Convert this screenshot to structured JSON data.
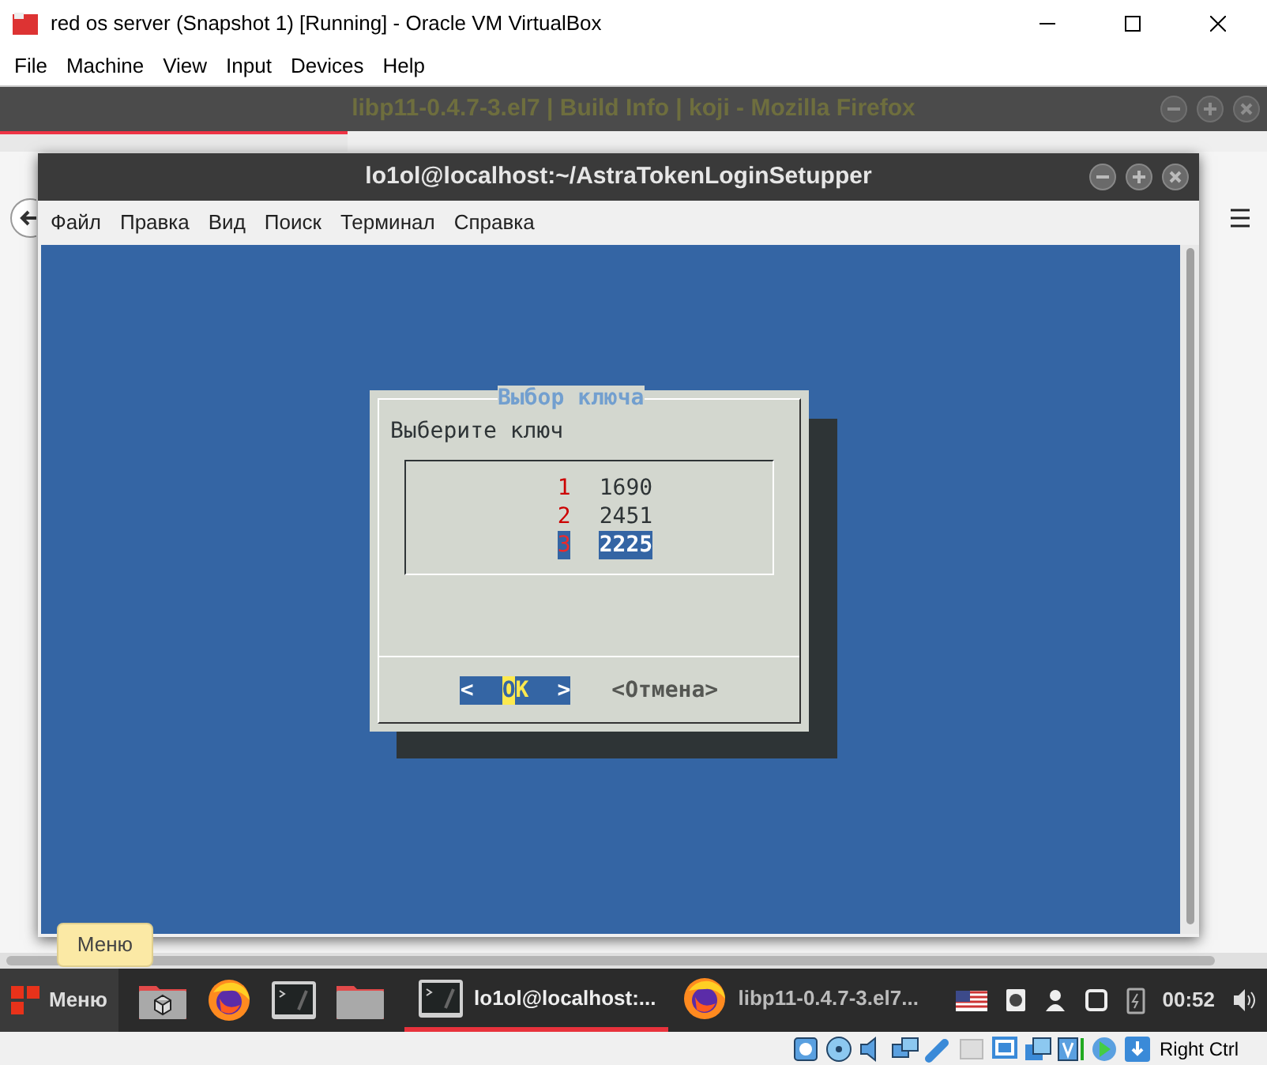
{
  "vbox": {
    "title": "red os server (Snapshot 1) [Running] - Oracle VM VirtualBox",
    "menu": [
      "File",
      "Machine",
      "View",
      "Input",
      "Devices",
      "Help"
    ],
    "host_key": "Right Ctrl"
  },
  "firefox": {
    "title": "libp11-0.4.7-3.el7 | Build Info | koji - Mozilla Firefox"
  },
  "terminal": {
    "title": "lo1ol@localhost:~/AstraTokenLoginSetupper",
    "menu": [
      "Файл",
      "Правка",
      "Вид",
      "Поиск",
      "Терминал",
      "Справка"
    ]
  },
  "dialog": {
    "title": "Выбор ключа",
    "prompt": "Выберите ключ",
    "items": [
      {
        "tag": "1",
        "value": "1690",
        "selected": false
      },
      {
        "tag": "2",
        "value": "2451",
        "selected": false
      },
      {
        "tag": "3",
        "value": "2225",
        "selected": true
      }
    ],
    "buttons": [
      {
        "open": "<",
        "label": "OK",
        "close": ">",
        "selected": true
      },
      {
        "open": "<",
        "label": "Отмена",
        "close": ">",
        "selected": false
      }
    ]
  },
  "taskbar": {
    "menu_label": "Меню",
    "tooltip": "Меню",
    "tasks": [
      {
        "kind": "terminal",
        "label": "lo1ol@localhost:...",
        "selected": true
      },
      {
        "kind": "firefox",
        "label": "libp11-0.4.7-3.el7...",
        "selected": false
      }
    ],
    "clock": "00:52"
  }
}
